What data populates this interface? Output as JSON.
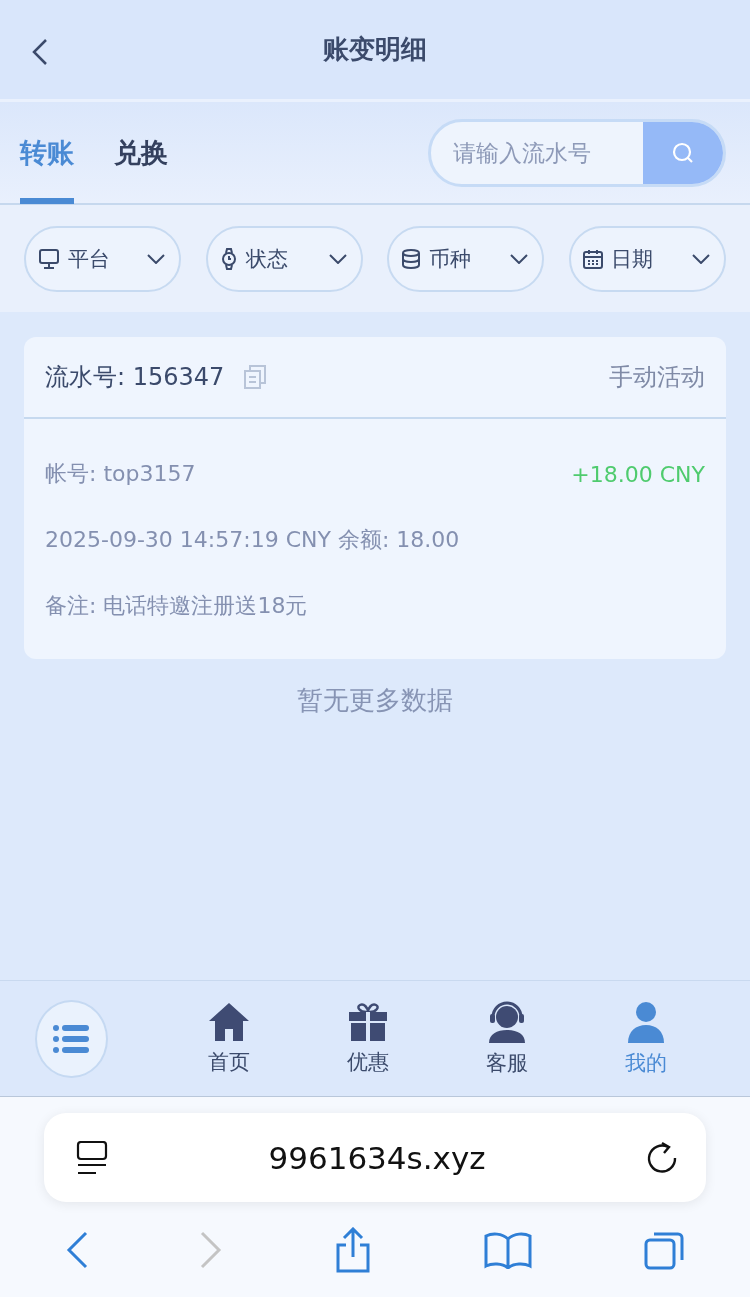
{
  "header": {
    "title": "账变明细"
  },
  "tabs": [
    {
      "label": "转账",
      "selected": true
    },
    {
      "label": "兑换",
      "selected": false
    }
  ],
  "search": {
    "placeholder": "请输入流水号"
  },
  "filters": [
    {
      "kind": "monitor",
      "label": "平台"
    },
    {
      "kind": "watch",
      "label": "状态"
    },
    {
      "kind": "coins",
      "label": "币种"
    },
    {
      "kind": "calendar",
      "label": "日期"
    }
  ],
  "records": [
    {
      "serial": "流水号: 156347",
      "type": "手动活动",
      "account": "帐号: top3157",
      "amount": "+18.00 CNY",
      "time_balance": "2025-09-30 14:57:19 CNY 余额: 18.00",
      "note": "备注: 电话特邀注册送18元"
    }
  ],
  "empty_text": "暂无更多数据",
  "bottom_nav": [
    {
      "kind": "home",
      "label": "首页",
      "selected": false
    },
    {
      "kind": "gift",
      "label": "优惠",
      "selected": false
    },
    {
      "kind": "support",
      "label": "客服",
      "selected": false
    },
    {
      "kind": "user",
      "label": "我的",
      "selected": true
    }
  ],
  "browser": {
    "url": "9961634s.xyz",
    "back_disabled": false,
    "forward_disabled": true
  }
}
